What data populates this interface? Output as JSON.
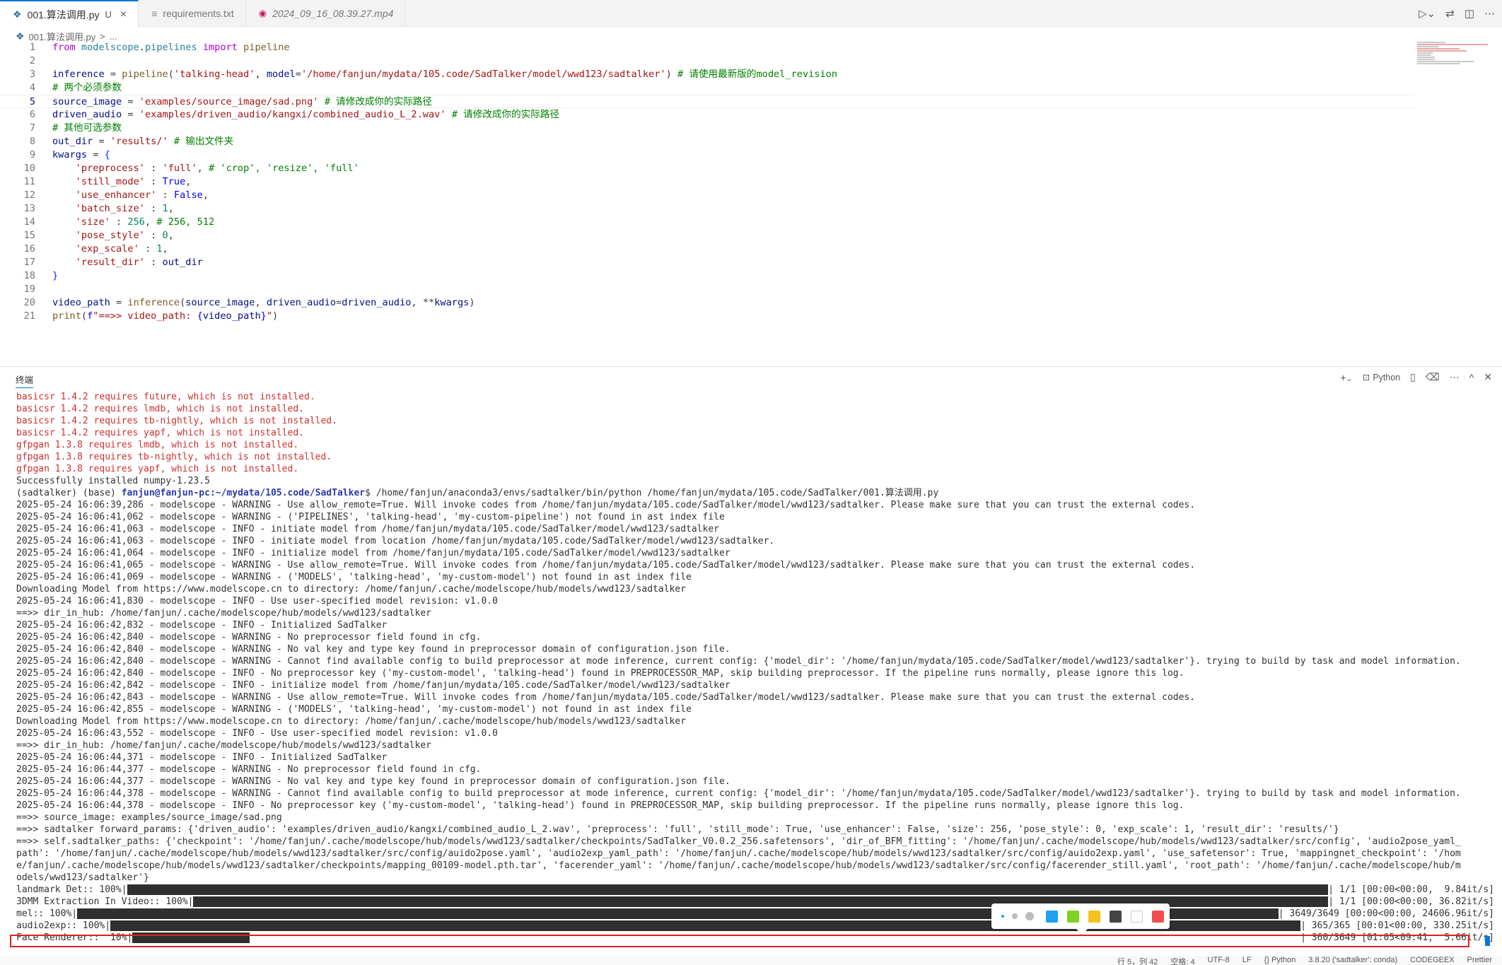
{
  "tabs": [
    {
      "label": "001.算法调用.py",
      "badge": "U",
      "icon": "python-file-icon",
      "active": true
    },
    {
      "label": "requirements.txt",
      "icon": "text-file-icon",
      "active": false
    },
    {
      "label": "2024_09_16_08.39.27.mp4",
      "icon": "video-file-icon",
      "active": false
    }
  ],
  "breadcrumb": {
    "file": "001.算法调用.py",
    "sep": ">",
    "rest": "..."
  },
  "editor": {
    "current_line": 5,
    "lines": [
      {
        "n": "1"
      },
      {
        "n": "2"
      },
      {
        "n": "3"
      },
      {
        "n": "4"
      },
      {
        "n": "5"
      },
      {
        "n": "6"
      },
      {
        "n": "7"
      },
      {
        "n": "8"
      },
      {
        "n": "9"
      },
      {
        "n": "10"
      },
      {
        "n": "11"
      },
      {
        "n": "12"
      },
      {
        "n": "13"
      },
      {
        "n": "14"
      },
      {
        "n": "15"
      },
      {
        "n": "16"
      },
      {
        "n": "17"
      },
      {
        "n": "18"
      },
      {
        "n": "19"
      },
      {
        "n": "20"
      },
      {
        "n": "21"
      }
    ],
    "code": {
      "l1": [
        "from",
        " modelscope",
        ".",
        "pipelines",
        " import",
        " pipeline"
      ],
      "l3": [
        "inference",
        " = ",
        "pipeline",
        "(",
        "'talking-head'",
        ", ",
        "model",
        "=",
        "'/home/fanjun/mydata/105.code/SadTalker/model/wwd123/sadtalker'",
        ") ",
        "# 请使用最新版的model_revision"
      ],
      "l4": "# 两个必须参数",
      "l5": [
        "source_image",
        " = ",
        "'examples/source_image/sad.png'",
        " ",
        "# 请修改成你的实际路径"
      ],
      "l6": [
        "driven_audio",
        " = ",
        "'examples/driven_audio/kangxi/combined_audio_L_2.wav'",
        " ",
        "# 请修改成你的实际路径"
      ],
      "l7": "# 其他可选参数",
      "l8": [
        "out_dir",
        " = ",
        "'results/'",
        " ",
        "# 输出文件夹"
      ],
      "l9": [
        "kwargs",
        " = ",
        "{"
      ],
      "l10": [
        "'preprocess'",
        " : ",
        "'full'",
        ", ",
        "# 'crop', 'resize', 'full'"
      ],
      "l11": [
        "'still_mode'",
        " : ",
        "True",
        ","
      ],
      "l12": [
        "'use_enhancer'",
        " : ",
        "False",
        ","
      ],
      "l13": [
        "'batch_size'",
        " : ",
        "1",
        ","
      ],
      "l14": [
        "'size'",
        " : ",
        "256",
        ", ",
        "# 256, 512"
      ],
      "l15": [
        "'pose_style'",
        " : ",
        "0",
        ","
      ],
      "l16": [
        "'exp_scale'",
        " : ",
        "1",
        ","
      ],
      "l17": [
        "'result_dir'",
        " : ",
        "out_dir"
      ],
      "l18": "}",
      "l20": [
        "video_path",
        " = ",
        "inference",
        "(",
        "source_image",
        ", ",
        "driven_audio",
        "=",
        "driven_audio",
        ", **",
        "kwargs",
        ")"
      ],
      "l21": [
        "print",
        "(",
        "f",
        "\"==>> video_path: ",
        "{",
        "video_path",
        "}",
        "\"",
        ")"
      ]
    }
  },
  "panel": {
    "title": "终端",
    "shell_label": "Python",
    "add": "+",
    "dropdown": "⌄",
    "split": "▯",
    "trash": "🗑",
    "more": "⋯",
    "maximize": "^",
    "close": "✕"
  },
  "terminal": {
    "errors": [
      "basicsr 1.4.2 requires future, which is not installed.",
      "basicsr 1.4.2 requires lmdb, which is not installed.",
      "basicsr 1.4.2 requires tb-nightly, which is not installed.",
      "basicsr 1.4.2 requires yapf, which is not installed.",
      "gfpgan 1.3.8 requires lmdb, which is not installed.",
      "gfpgan 1.3.8 requires tb-nightly, which is not installed.",
      "gfpgan 1.3.8 requires yapf, which is not installed."
    ],
    "success": "Successfully installed numpy-1.23.5",
    "prompt_env": "(sadtalker) (base) ",
    "prompt_host": "fanjun@fanjun-pc:~/mydata/105.code/SadTalker",
    "prompt_cmd": "$ /home/fanjun/anaconda3/envs/sadtalker/bin/python /home/fanjun/mydata/105.code/SadTalker/001.算法调用.py",
    "log": [
      "2025-05-24 16:06:39,286 - modelscope - WARNING - Use allow_remote=True. Will invoke codes from /home/fanjun/mydata/105.code/SadTalker/model/wwd123/sadtalker. Please make sure that you can trust the external codes.",
      "2025-05-24 16:06:41,062 - modelscope - WARNING - ('PIPELINES', 'talking-head', 'my-custom-pipeline') not found in ast index file",
      "2025-05-24 16:06:41,063 - modelscope - INFO - initiate model from /home/fanjun/mydata/105.code/SadTalker/model/wwd123/sadtalker",
      "2025-05-24 16:06:41,063 - modelscope - INFO - initiate model from location /home/fanjun/mydata/105.code/SadTalker/model/wwd123/sadtalker.",
      "2025-05-24 16:06:41,064 - modelscope - INFO - initialize model from /home/fanjun/mydata/105.code/SadTalker/model/wwd123/sadtalker",
      "2025-05-24 16:06:41,065 - modelscope - WARNING - Use allow_remote=True. Will invoke codes from /home/fanjun/mydata/105.code/SadTalker/model/wwd123/sadtalker. Please make sure that you can trust the external codes.",
      "2025-05-24 16:06:41,069 - modelscope - WARNING - ('MODELS', 'talking-head', 'my-custom-model') not found in ast index file",
      "Downloading Model from https://www.modelscope.cn to directory: /home/fanjun/.cache/modelscope/hub/models/wwd123/sadtalker",
      "2025-05-24 16:06:41,830 - modelscope - INFO - Use user-specified model revision: v1.0.0",
      "==>> dir_in_hub: /home/fanjun/.cache/modelscope/hub/models/wwd123/sadtalker",
      "2025-05-24 16:06:42,832 - modelscope - INFO - Initialized SadTalker",
      "2025-05-24 16:06:42,840 - modelscope - WARNING - No preprocessor field found in cfg.",
      "2025-05-24 16:06:42,840 - modelscope - WARNING - No val key and type key found in preprocessor domain of configuration.json file.",
      "2025-05-24 16:06:42,840 - modelscope - WARNING - Cannot find available config to build preprocessor at mode inference, current config: {'model_dir': '/home/fanjun/mydata/105.code/SadTalker/model/wwd123/sadtalker'}. trying to build by task and model information.",
      "2025-05-24 16:06:42,840 - modelscope - INFO - No preprocessor key ('my-custom-model', 'talking-head') found in PREPROCESSOR_MAP, skip building preprocessor. If the pipeline runs normally, please ignore this log.",
      "2025-05-24 16:06:42,842 - modelscope - INFO - initialize model from /home/fanjun/mydata/105.code/SadTalker/model/wwd123/sadtalker",
      "2025-05-24 16:06:42,843 - modelscope - WARNING - Use allow_remote=True. Will invoke codes from /home/fanjun/mydata/105.code/SadTalker/model/wwd123/sadtalker. Please make sure that you can trust the external codes.",
      "2025-05-24 16:06:42,855 - modelscope - WARNING - ('MODELS', 'talking-head', 'my-custom-model') not found in ast index file",
      "Downloading Model from https://www.modelscope.cn to directory: /home/fanjun/.cache/modelscope/hub/models/wwd123/sadtalker",
      "2025-05-24 16:06:43,552 - modelscope - INFO - Use user-specified model revision: v1.0.0",
      "==>> dir_in_hub: /home/fanjun/.cache/modelscope/hub/models/wwd123/sadtalker",
      "2025-05-24 16:06:44,371 - modelscope - INFO - Initialized SadTalker",
      "2025-05-24 16:06:44,377 - modelscope - WARNING - No preprocessor field found in cfg.",
      "2025-05-24 16:06:44,377 - modelscope - WARNING - No val key and type key found in preprocessor domain of configuration.json file.",
      "2025-05-24 16:06:44,378 - modelscope - WARNING - Cannot find available config to build preprocessor at mode inference, current config: {'model_dir': '/home/fanjun/mydata/105.code/SadTalker/model/wwd123/sadtalker'}. trying to build by task and model information.",
      "2025-05-24 16:06:44,378 - modelscope - INFO - No preprocessor key ('my-custom-model', 'talking-head') found in PREPROCESSOR_MAP, skip building preprocessor. If the pipeline runs normally, please ignore this log.",
      "==>> source_image: examples/source_image/sad.png",
      "==>> sadtalker forward_params: {'driven_audio': 'examples/driven_audio/kangxi/combined_audio_L_2.wav', 'preprocess': 'full', 'still_mode': True, 'use_enhancer': False, 'size': 256, 'pose_style': 0, 'exp_scale': 1, 'result_dir': 'results/'}",
      "==>> self.sadtalker_paths: {'checkpoint': '/home/fanjun/.cache/modelscope/hub/models/wwd123/sadtalker/checkpoints/SadTalker_V0.0.2_256.safetensors', 'dir_of_BFM_fitting': '/home/fanjun/.cache/modelscope/hub/models/wwd123/sadtalker/src/config', 'audio2pose_yaml_",
      "path': '/home/fanjun/.cache/modelscope/hub/models/wwd123/sadtalker/src/config/auido2pose.yaml', 'audio2exp_yaml_path': '/home/fanjun/.cache/modelscope/hub/models/wwd123/sadtalker/src/config/auido2exp.yaml', 'use_safetensor': True, 'mappingnet_checkpoint': '/hom",
      "e/fanjun/.cache/modelscope/hub/models/wwd123/sadtalker/checkpoints/mapping_00109-model.pth.tar', 'facerender_yaml': '/home/fanjun/.cache/modelscope/hub/models/wwd123/sadtalker/src/config/facerender_still.yaml', 'root_path': '/home/fanjun/.cache/modelscope/hub/m",
      "odels/wwd123/sadtalker'}"
    ],
    "progress": [
      {
        "label": "landmark Det:: 100%|",
        "fraction": 1.0,
        "stats": "| 1/1 [00:00<00:00,  9.84it/s]"
      },
      {
        "label": "3DMM Extraction In Video:: 100%|",
        "fraction": 1.0,
        "stats": "| 1/1 [00:00<00:00, 36.82it/s]"
      },
      {
        "label": "mel:: 100%|",
        "fraction": 1.0,
        "stats": "| 3649/3649 [00:00<00:00, 24606.96it/s]"
      },
      {
        "label": "audio2exp:: 100%|",
        "fraction": 1.0,
        "stats": "| 365/365 [00:01<00:00, 330.25it/s]"
      },
      {
        "label": "Face Renderer::  10%|",
        "fraction": 0.1,
        "stats": "| 360/3649 [01:05<09:41,  5.66it/s]"
      }
    ]
  },
  "status_bar": [
    "行 5，列 42",
    "空格: 4",
    "UTF-8",
    "LF",
    "{} Python",
    "3.8.20 ('sadtalker': conda)",
    "CODEGEEX",
    "Prettier"
  ],
  "annotation_colors": [
    "#1ea1f2",
    "#7ed321",
    "#f5c21b",
    "#444444",
    "#ffffff",
    "#f24e4e"
  ]
}
